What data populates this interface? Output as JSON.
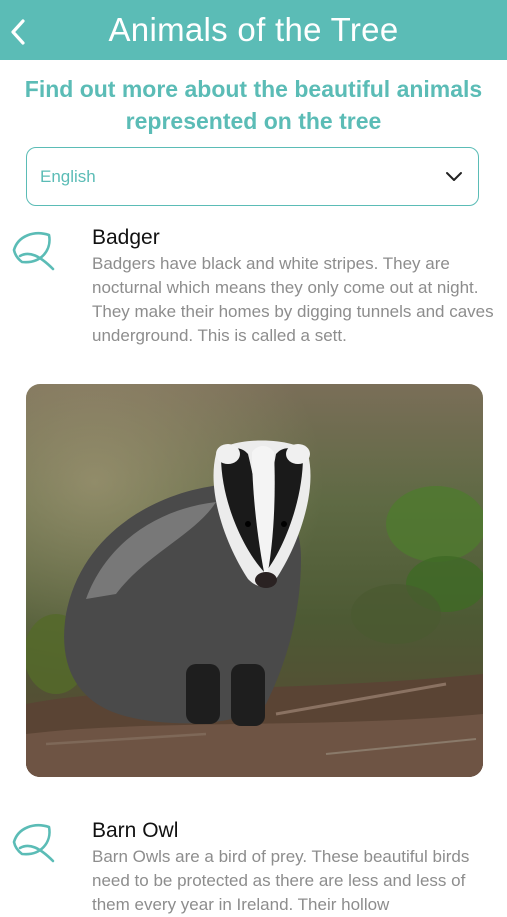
{
  "header": {
    "title": "Animals of the Tree",
    "back_icon": "chevron-left-icon"
  },
  "intro": {
    "text": "Find out more about the beautiful animals represented on the tree"
  },
  "language_select": {
    "selected": "English",
    "icon": "chevron-down-icon"
  },
  "colors": {
    "accent": "#5bbcb6",
    "description_text": "#8d8d8d",
    "title_text": "#111111"
  },
  "animals": [
    {
      "icon": "leaf-icon",
      "name": "Badger",
      "description": "Badgers have black and white stripes. They are nocturnal which means they only come out at night. They make their homes by digging tunnels and caves underground. This is called a sett.",
      "image": "badger-photo"
    },
    {
      "icon": "leaf-icon",
      "name": "Barn Owl",
      "description": "Barn Owls are a bird of prey. These beautiful birds need to be protected as there are less and less of them every year in Ireland. Their hollow"
    }
  ]
}
